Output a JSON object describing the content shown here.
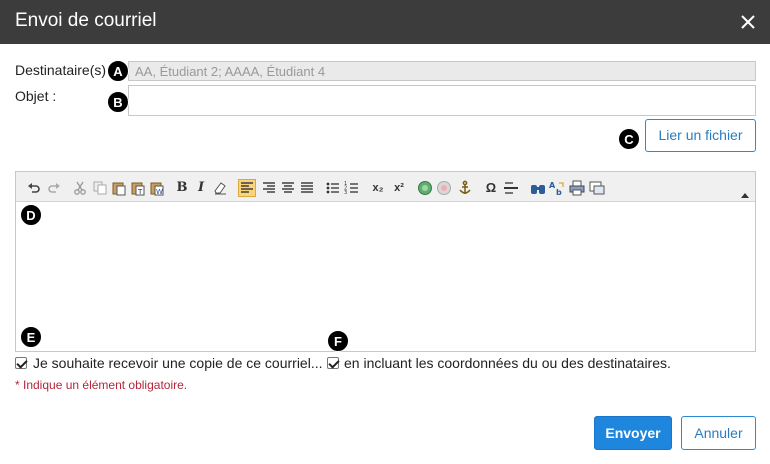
{
  "dialog": {
    "title": "Envoi de courriel",
    "close_icon": "close-icon"
  },
  "form": {
    "recipient_label": "Destinataire(s)",
    "recipient_value": "AA, Étudiant 2; AAAA, Étudiant 4",
    "subject_label": "Objet :",
    "subject_value": "",
    "attach_button": "Lier un fichier",
    "copy_checkbox_label": "Je souhaite recevoir une copie de ce courriel...",
    "copy_checked": true,
    "include_checkbox_label": "en incluant les coordonnées du ou des destinataires.",
    "include_checked": true,
    "required_note": "* Indique un élément obligatoire."
  },
  "badges": [
    "A",
    "B",
    "C",
    "D",
    "E",
    "F"
  ],
  "toolbar": {
    "icons": [
      "undo-icon",
      "redo-icon",
      "cut-icon",
      "copy-icon",
      "paste-icon",
      "paste-text-icon",
      "paste-word-icon",
      "bold-icon",
      "italic-icon",
      "remove-format-icon",
      "align-left-icon",
      "align-right-icon",
      "align-center-icon",
      "justify-icon",
      "bulleted-list-icon",
      "numbered-list-icon",
      "subscript-icon",
      "superscript-icon",
      "link-icon",
      "unlink-icon",
      "anchor-icon",
      "special-char-icon",
      "horizontal-rule-icon",
      "find-icon",
      "replace-icon",
      "print-icon",
      "preview-icon",
      "expand-toolbar-icon"
    ],
    "bold_glyph": "B",
    "italic_glyph": "I",
    "subscript_glyph": "x₂",
    "superscript_glyph": "x²",
    "omega_glyph": "Ω"
  },
  "actions": {
    "send": "Envoyer",
    "cancel": "Annuler"
  },
  "colors": {
    "titlebar": "#3c3c3c",
    "primary": "#1f86dd",
    "required": "#b3263a"
  }
}
